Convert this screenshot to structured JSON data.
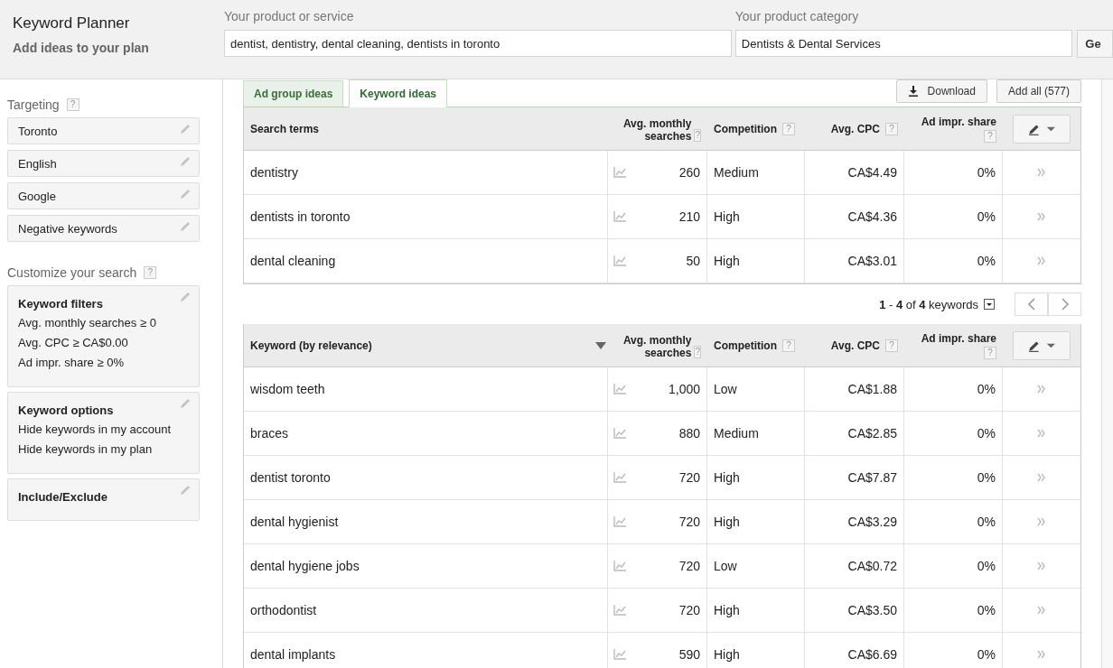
{
  "header": {
    "title": "Keyword Planner",
    "subtitle": "Add ideas to your plan"
  },
  "product_field": {
    "label": "Your product or service",
    "value": "dentist, dentistry, dental cleaning, dentists in toronto"
  },
  "category_field": {
    "label": "Your product category",
    "value": "Dentists & Dental Services"
  },
  "get_button": "Ge",
  "sidebar": {
    "targeting_title": "Targeting",
    "targeting_help": "?",
    "targeting_items": [
      "Toronto",
      "English",
      "Google",
      "Negative keywords"
    ],
    "customize_title": "Customize your search",
    "customize_help": "?",
    "cards": [
      {
        "title": "Keyword filters",
        "lines": [
          "Avg. monthly searches ≥ 0",
          "Avg. CPC ≥ CA$0.00",
          "Ad impr. share ≥ 0%"
        ]
      },
      {
        "title": "Keyword options",
        "lines": [
          "Hide keywords in my account",
          "Hide keywords in my plan"
        ]
      },
      {
        "title": "Include/Exclude"
      }
    ]
  },
  "tabs": [
    {
      "label": "Ad group ideas",
      "selected": false
    },
    {
      "label": "Keyword ideas",
      "selected": true
    }
  ],
  "download_button": "Download",
  "add_all_button": "Add all (577)",
  "search_table": {
    "columns": [
      {
        "label": "Search terms"
      },
      {
        "label": "Avg. monthly searches",
        "help": "?"
      },
      {
        "label": "Competition",
        "help": "?"
      },
      {
        "label": "Avg. CPC",
        "help": "?"
      },
      {
        "label": "Ad impr. share",
        "help": "?"
      }
    ],
    "rows": [
      {
        "term": "dentistry",
        "searches": "260",
        "competition": "Medium",
        "cpc": "CA$4.49",
        "share": "0%"
      },
      {
        "term": "dentists in toronto",
        "searches": "210",
        "competition": "High",
        "cpc": "CA$4.36",
        "share": "0%"
      },
      {
        "term": "dental cleaning",
        "searches": "50",
        "competition": "High",
        "cpc": "CA$3.01",
        "share": "0%"
      }
    ]
  },
  "pagination": "**1** - **4** of **4** keywords",
  "keyword_table": {
    "columns": [
      {
        "label": "Keyword (by relevance)"
      },
      {
        "label": "Avg. monthly searches",
        "help": "?"
      },
      {
        "label": "Competition",
        "help": "?"
      },
      {
        "label": "Avg. CPC",
        "help": "?"
      },
      {
        "label": "Ad impr. share",
        "help": "?"
      }
    ],
    "rows": [
      {
        "term": "wisdom teeth",
        "searches": "1,000",
        "competition": "Low",
        "cpc": "CA$1.88",
        "share": "0%"
      },
      {
        "term": "braces",
        "searches": "880",
        "competition": "Medium",
        "cpc": "CA$2.85",
        "share": "0%"
      },
      {
        "term": "dentist toronto",
        "searches": "720",
        "competition": "High",
        "cpc": "CA$7.87",
        "share": "0%"
      },
      {
        "term": "dental hygienist",
        "searches": "720",
        "competition": "High",
        "cpc": "CA$3.29",
        "share": "0%"
      },
      {
        "term": "dental hygiene jobs",
        "searches": "720",
        "competition": "Low",
        "cpc": "CA$0.72",
        "share": "0%"
      },
      {
        "term": "orthodontist",
        "searches": "720",
        "competition": "High",
        "cpc": "CA$3.50",
        "share": "0%"
      },
      {
        "term": "dental implants",
        "searches": "590",
        "competition": "High",
        "cpc": "CA$6.69",
        "share": "0%"
      }
    ]
  }
}
